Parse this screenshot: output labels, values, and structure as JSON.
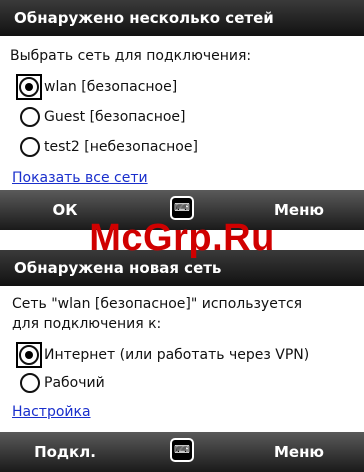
{
  "screen1": {
    "title": "Обнаружено несколько сетей",
    "prompt": "Выбрать сеть для подключения:",
    "options": [
      {
        "label": "wlan [безопасное]",
        "selected": true
      },
      {
        "label": "Guest [безопасное]",
        "selected": false
      },
      {
        "label": "test2 [небезопасное]",
        "selected": false
      }
    ],
    "link": "Показать все сети",
    "softkeys": {
      "left": "ОК",
      "right": "Меню",
      "input_icon": "keyboard-icon"
    }
  },
  "screen2": {
    "title": "Обнаружена новая сеть",
    "prompt_line1": "Сеть \"wlan [безопасное]\" используется",
    "prompt_line2": "для подключения к:",
    "options": [
      {
        "label": "Интернет (или работать через VPN)",
        "selected": true
      },
      {
        "label": "Рабочий",
        "selected": false
      }
    ],
    "link": "Настройка",
    "softkeys": {
      "left": "Подкл.",
      "right": "Меню",
      "input_icon": "keyboard-icon"
    }
  },
  "watermark": "McGrp.Ru"
}
